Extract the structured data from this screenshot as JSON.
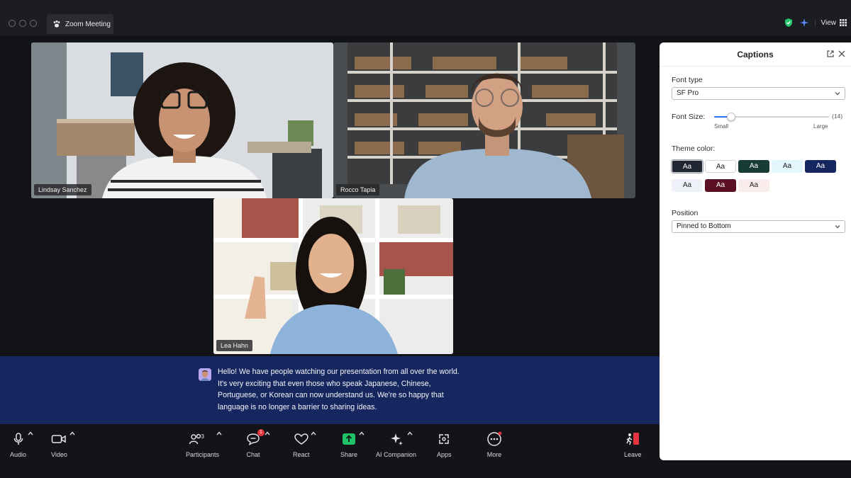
{
  "window": {
    "tab_title": "Zoom Meeting",
    "view_label": "View"
  },
  "participants_video": [
    {
      "name": "Lindsay Sanchez"
    },
    {
      "name": "Rocco Tapia"
    },
    {
      "name": "Lea Hahn"
    }
  ],
  "caption": {
    "lines": [
      "Hello! We have people watching our presentation from all over the world.",
      "It's very exciting that even those who speak Japanese, Chinese,",
      "Portuguese, or Korean can now understand us. We're so happy that",
      "language is no longer a barrier to sharing ideas."
    ]
  },
  "toolbar": {
    "audio": "Audio",
    "video": "Video",
    "participants": "Participants",
    "participants_count": "3",
    "chat": "Chat",
    "chat_badge": "1",
    "react": "React",
    "share": "Share",
    "ai_companion": "AI Companion",
    "apps": "Apps",
    "more": "More",
    "leave": "Leave"
  },
  "captions_panel": {
    "title": "Captions",
    "font_type_label": "Font type",
    "font_type_value": "SF Pro",
    "font_size_label": "Font Size:",
    "font_size_value": "(14)",
    "font_size_min": "Small",
    "font_size_max": "Large",
    "font_size_level": 0.15,
    "theme_color_label": "Theme color:",
    "theme_swatches": [
      {
        "text": "Aa",
        "bg": "#202632",
        "fg": "#ffffff",
        "selected": true
      },
      {
        "text": "Aa",
        "bg": "#ffffff",
        "fg": "#1d1d1f",
        "selected": false
      },
      {
        "text": "Aa",
        "bg": "#173b35",
        "fg": "#ffffff",
        "selected": false
      },
      {
        "text": "Aa",
        "bg": "#e2f6fb",
        "fg": "#1d1d1f",
        "selected": false
      },
      {
        "text": "Aa",
        "bg": "#16265e",
        "fg": "#ffffff",
        "selected": false
      },
      {
        "text": "Aa",
        "bg": "#eef1f8",
        "fg": "#1d1d1f",
        "selected": false
      },
      {
        "text": "Aa",
        "bg": "#5a0f22",
        "fg": "#ffffff",
        "selected": false
      },
      {
        "text": "Aa",
        "bg": "#fbecec",
        "fg": "#1d1d1f",
        "selected": false
      }
    ],
    "position_label": "Position",
    "position_value": "Pinned to Bottom"
  },
  "colors": {
    "caption_bg": "#16265e",
    "app_bg": "#121417",
    "accent": "#2d6ef5",
    "shield": "#28c76f",
    "badge": "#e5343f"
  }
}
